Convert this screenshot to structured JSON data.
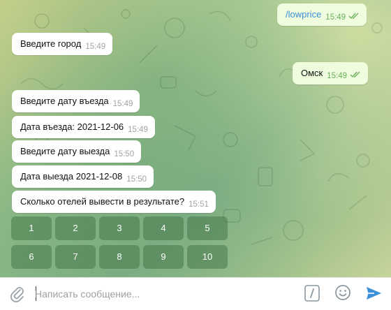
{
  "colors": {
    "accent": "#3a8fd6",
    "outgoing_bubble": "#effdde",
    "incoming_bubble": "#ffffff",
    "check": "#6bb05d"
  },
  "messages": [
    {
      "direction": "out",
      "text": "/lowprice",
      "time": "15:49",
      "read": true
    },
    {
      "direction": "in",
      "text": "Введите город",
      "time": "15:49"
    },
    {
      "direction": "out",
      "text": "Омск",
      "time": "15:49",
      "read": true
    },
    {
      "direction": "in",
      "text": "Введите дату въезда",
      "time": "15:49"
    },
    {
      "direction": "in",
      "text": "Дата въезда: 2021-12-06",
      "time": "15:49"
    },
    {
      "direction": "in",
      "text": "Введите дату выезда",
      "time": "15:50"
    },
    {
      "direction": "in",
      "text": "Дата выезда 2021-12-08",
      "time": "15:50"
    },
    {
      "direction": "in",
      "text": "Сколько отелей вывести в результате?",
      "time": "15:51"
    }
  ],
  "keyboard": {
    "rows": [
      [
        "1",
        "2",
        "3",
        "4",
        "5"
      ],
      [
        "6",
        "7",
        "8",
        "9",
        "10"
      ]
    ]
  },
  "composer": {
    "placeholder": "Написать сообщение...",
    "value": "",
    "icons": [
      "paperclip-icon",
      "slash-command-icon",
      "emoji-icon",
      "send-icon"
    ]
  }
}
